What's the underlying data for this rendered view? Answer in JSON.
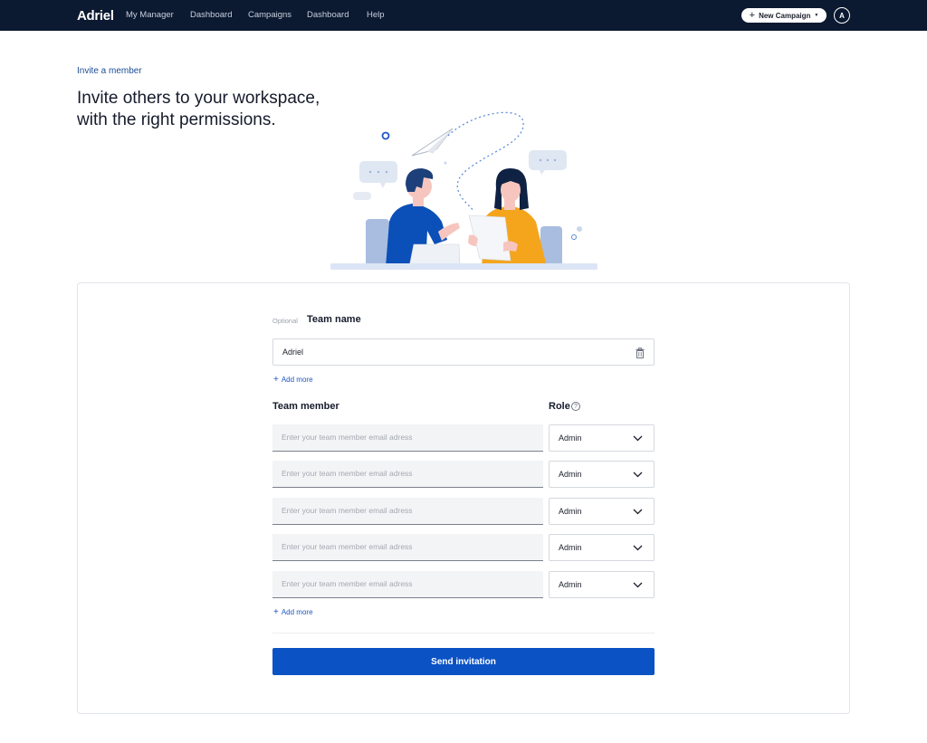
{
  "nav": {
    "logo": "Adriel",
    "items": [
      "My Manager",
      "Dashboard",
      "Campaigns",
      "Dashboard",
      "Help"
    ],
    "new_campaign_label": "New Campaign",
    "avatar_initial": "A"
  },
  "header": {
    "eyebrow": "Invite a member",
    "headline_line1": "Invite others to your workspace,",
    "headline_line2": "with the right permissions."
  },
  "form": {
    "optional_label": "Optional",
    "team_name_label": "Team name",
    "team_name_value": "Adriel",
    "add_more_label": "Add more",
    "team_member_label": "Team member",
    "role_label": "Role",
    "help_glyph": "?",
    "members": [
      {
        "placeholder": "Enter your team member email adress",
        "role": "Admin"
      },
      {
        "placeholder": "Enter your team member email adress",
        "role": "Admin"
      },
      {
        "placeholder": "Enter your team member email adress",
        "role": "Admin"
      },
      {
        "placeholder": "Enter your team member email adress",
        "role": "Admin"
      },
      {
        "placeholder": "Enter your team member email adress",
        "role": "Admin"
      }
    ],
    "send_label": "Send invitation"
  },
  "colors": {
    "nav_bg": "#0b1931",
    "accent": "#0b52c4",
    "link": "#1e57c0",
    "man_shirt": "#0b4fb8",
    "woman_shirt": "#f4a51c"
  }
}
